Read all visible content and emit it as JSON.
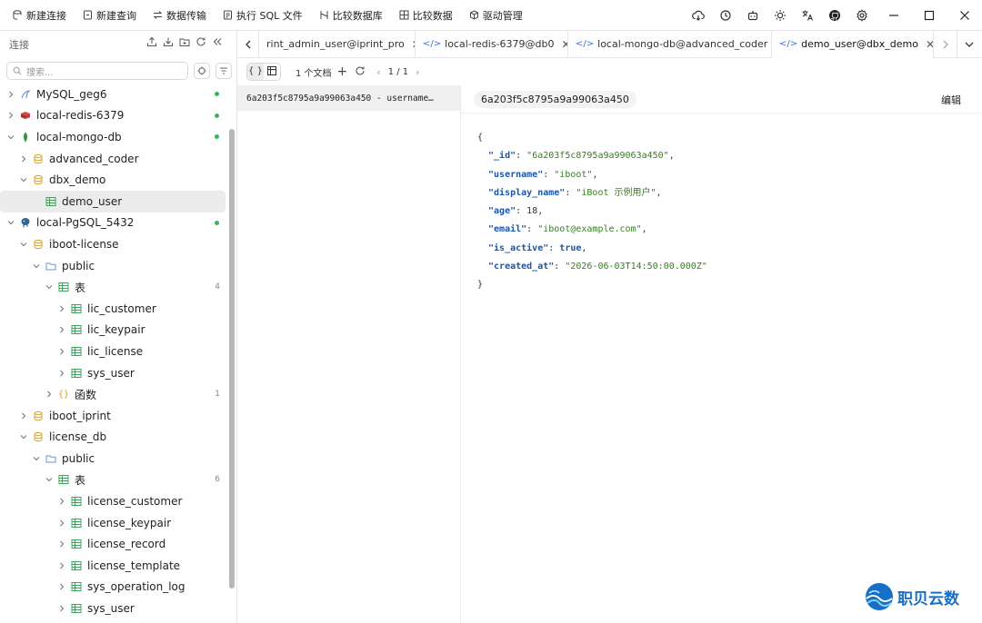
{
  "toolbar": {
    "buttons": [
      {
        "label": "新建连接",
        "icon": "database-plus-icon"
      },
      {
        "label": "新建查询",
        "icon": "file-edit-icon"
      },
      {
        "label": "数据传输",
        "icon": "transfer-icon"
      },
      {
        "label": "执行 SQL 文件",
        "icon": "file-run-icon"
      },
      {
        "label": "比较数据库",
        "icon": "compare-icon"
      },
      {
        "label": "比较数据",
        "icon": "grid-compare-icon"
      },
      {
        "label": "驱动管理",
        "icon": "package-icon"
      }
    ]
  },
  "sidebar": {
    "title": "连接",
    "search_placeholder": "搜索...",
    "tree": [
      {
        "label": "MySQL_geg6",
        "type": "mysql",
        "level": 0,
        "chevron": "right",
        "dot": true
      },
      {
        "label": "local-redis-6379",
        "type": "redis",
        "level": 0,
        "chevron": "right",
        "dot": true
      },
      {
        "label": "local-mongo-db",
        "type": "mongo",
        "level": 0,
        "chevron": "down",
        "dot": true
      },
      {
        "label": "advanced_coder",
        "type": "db",
        "level": 1,
        "chevron": "right"
      },
      {
        "label": "dbx_demo",
        "type": "db",
        "level": 1,
        "chevron": "down"
      },
      {
        "label": "demo_user",
        "type": "table",
        "level": 2,
        "chevron": "none",
        "selected": true
      },
      {
        "label": "local-PgSQL_5432",
        "type": "pgsql",
        "level": 0,
        "chevron": "down",
        "dot": true
      },
      {
        "label": "iboot-license",
        "type": "db",
        "level": 1,
        "chevron": "down"
      },
      {
        "label": "public",
        "type": "schema",
        "level": 2,
        "chevron": "down"
      },
      {
        "label": "表",
        "type": "table",
        "level": 3,
        "chevron": "down",
        "count": "4"
      },
      {
        "label": "lic_customer",
        "type": "table",
        "level": 4,
        "chevron": "right"
      },
      {
        "label": "lic_keypair",
        "type": "table",
        "level": 4,
        "chevron": "right"
      },
      {
        "label": "lic_license",
        "type": "table",
        "level": 4,
        "chevron": "right"
      },
      {
        "label": "sys_user",
        "type": "table",
        "level": 4,
        "chevron": "right"
      },
      {
        "label": "函数",
        "type": "func",
        "level": 3,
        "chevron": "right",
        "count": "1"
      },
      {
        "label": "iboot_iprint",
        "type": "db",
        "level": 1,
        "chevron": "right"
      },
      {
        "label": "license_db",
        "type": "db",
        "level": 1,
        "chevron": "down"
      },
      {
        "label": "public",
        "type": "schema",
        "level": 2,
        "chevron": "down"
      },
      {
        "label": "表",
        "type": "table",
        "level": 3,
        "chevron": "down",
        "count": "6"
      },
      {
        "label": "license_customer",
        "type": "table",
        "level": 4,
        "chevron": "right"
      },
      {
        "label": "license_keypair",
        "type": "table",
        "level": 4,
        "chevron": "right"
      },
      {
        "label": "license_record",
        "type": "table",
        "level": 4,
        "chevron": "right"
      },
      {
        "label": "license_template",
        "type": "table",
        "level": 4,
        "chevron": "right"
      },
      {
        "label": "sys_operation_log",
        "type": "table",
        "level": 4,
        "chevron": "right"
      },
      {
        "label": "sys_user",
        "type": "table",
        "level": 4,
        "chevron": "right"
      }
    ]
  },
  "tabs": [
    {
      "label": "rint_admin_user@iprint_pro",
      "code": false,
      "active": false
    },
    {
      "label": "local-redis-6379@db0",
      "code": true,
      "active": false
    },
    {
      "label": "local-mongo-db@advanced_coder",
      "code": true,
      "active": false
    },
    {
      "label": "demo_user@dbx_demo",
      "code": true,
      "active": true
    }
  ],
  "subbar": {
    "doc_count": "1 个文档",
    "page": "1 / 1",
    "view_json": "{ }"
  },
  "list": {
    "row": "6a203f5c8795a9a99063a450 - username…"
  },
  "detail": {
    "id_pill": "6a203f5c8795a9a99063a450",
    "edit_label": "编辑",
    "doc": [
      {
        "key": "_id",
        "value": "\"6a203f5c8795a9a99063a450\"",
        "kind": "s"
      },
      {
        "key": "username",
        "value": "\"iboot\"",
        "kind": "s"
      },
      {
        "key": "display_name",
        "value": "\"iBoot 示例用户\"",
        "kind": "s"
      },
      {
        "key": "age",
        "value": "18",
        "kind": "n"
      },
      {
        "key": "email",
        "value": "\"iboot@example.com\"",
        "kind": "s"
      },
      {
        "key": "is_active",
        "value": "true",
        "kind": "b"
      },
      {
        "key": "created_at",
        "value": "\"2026-06-03T14:50:00.000Z\"",
        "kind": "s",
        "last": true
      }
    ]
  },
  "watermark": {
    "text": "职贝云数"
  },
  "colors": {
    "accent": "#3b74d6",
    "online": "#3db35a",
    "json_key": "#1c55a8",
    "json_string": "#3c7a2a"
  }
}
